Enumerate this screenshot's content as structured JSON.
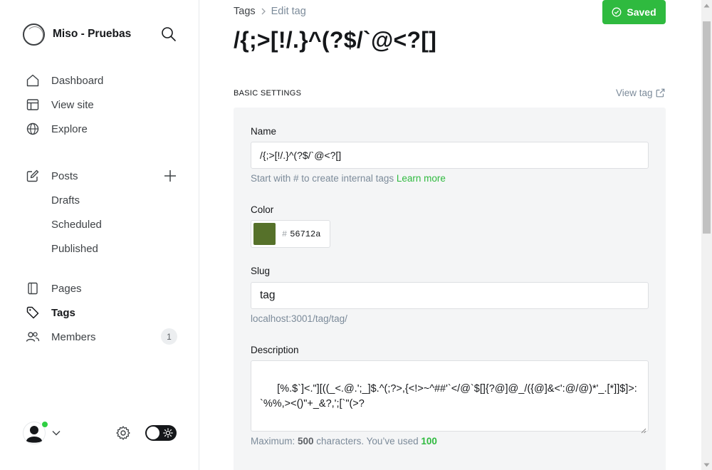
{
  "sidebar": {
    "brand_name": "Miso - Pruebas",
    "nav": {
      "dashboard": "Dashboard",
      "view_site": "View site",
      "explore": "Explore",
      "posts": "Posts",
      "drafts": "Drafts",
      "scheduled": "Scheduled",
      "published": "Published",
      "pages": "Pages",
      "tags": "Tags",
      "members": "Members"
    },
    "members_count": "1",
    "active_item": "tags"
  },
  "header": {
    "breadcrumb_parent": "Tags",
    "breadcrumb_current": "Edit tag",
    "title": "/{;>[!/.}^(?$/`@<?[]",
    "saved_label": "Saved"
  },
  "section": {
    "label": "BASIC SETTINGS",
    "view_tag_label": "View tag"
  },
  "form": {
    "name_label": "Name",
    "name_value": "/{;>[!/.}^(?$/`@<?[]",
    "name_help": "Start with # to create internal tags ",
    "name_help_link": "Learn more",
    "color_label": "Color",
    "color_hash": "#",
    "color_value": "56712a",
    "color_swatch": "#56712a",
    "slug_label": "Slug",
    "slug_value": "tag",
    "slug_help": "localhost:3001/tag/tag/",
    "description_label": "Description",
    "description_value": "[%.$`]<.\"][((_<.@.';_]$.^(;?>,{<!>~^##'`</@`$[]{?@]@_/({@]&<':@/@)*'_.[*]]$]>:`%%,><()\"+_&?,';[`\"(>?",
    "max_label": "Maximum: ",
    "max_value": "500",
    "used_label": " characters. You’ve used ",
    "used_value": "100"
  },
  "colors": {
    "accent": "#30cf43",
    "saved_button": "#2fba3f",
    "panel_bg": "#f4f5f6"
  }
}
